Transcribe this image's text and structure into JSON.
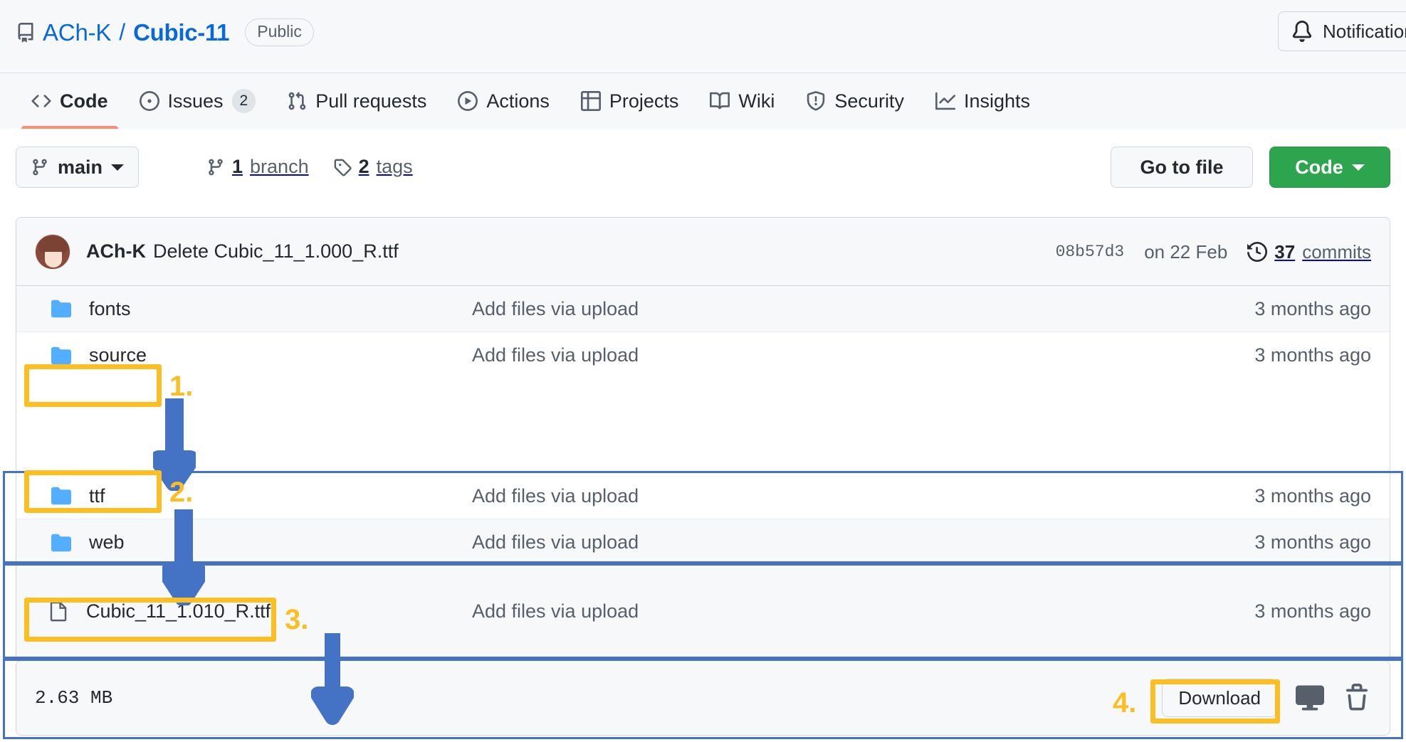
{
  "header": {
    "repo_icon": "repo-icon",
    "owner": "ACh-K",
    "separator": "/",
    "name": "Cubic-11",
    "visibility": "Public",
    "notifications_label": "Notifications",
    "notifications_icon": "bell-icon"
  },
  "nav": {
    "tabs": [
      {
        "label": "Code",
        "icon": "code-icon",
        "count": null,
        "active": true
      },
      {
        "label": "Issues",
        "icon": "issue-opened-icon",
        "count": "2",
        "active": false
      },
      {
        "label": "Pull requests",
        "icon": "git-pull-request-icon",
        "count": null,
        "active": false
      },
      {
        "label": "Actions",
        "icon": "play-icon",
        "count": null,
        "active": false
      },
      {
        "label": "Projects",
        "icon": "table-icon",
        "count": null,
        "active": false
      },
      {
        "label": "Wiki",
        "icon": "book-icon",
        "count": null,
        "active": false
      },
      {
        "label": "Security",
        "icon": "shield-icon",
        "count": null,
        "active": false
      },
      {
        "label": "Insights",
        "icon": "graph-icon",
        "count": null,
        "active": false
      }
    ]
  },
  "toolbar": {
    "branch_name": "main",
    "branch_icon": "git-branch-icon",
    "branch_count": "1",
    "branch_word": "branch",
    "tag_count": "2",
    "tag_word": "tags",
    "tag_icon": "tag-icon",
    "go_to_file_label": "Go to file",
    "code_label": "Code"
  },
  "commit_bar": {
    "avatar": "user-avatar",
    "author": "ACh-K",
    "message": "Delete Cubic_11_1.000_R.ttf",
    "hash": "08b57d3",
    "date": "on 22 Feb",
    "commits_count": "37",
    "commits_word": "commits",
    "history_icon": "history-icon"
  },
  "files": [
    {
      "name": "fonts",
      "type": "folder",
      "commit": "Add files via upload",
      "time": "3 months ago"
    },
    {
      "name": "source",
      "type": "folder",
      "commit": "Add files via upload",
      "time": "3 months ago"
    },
    {
      "name": "ttf",
      "type": "folder",
      "commit": "Add files via upload",
      "time": "3 months ago"
    },
    {
      "name": "web",
      "type": "folder",
      "commit": "Add files via upload",
      "time": "3 months ago"
    },
    {
      "name": "Cubic_11_1.010_R.ttf",
      "type": "file",
      "commit": "Add files via upload",
      "time": "3 months ago"
    }
  ],
  "footer": {
    "file_size": "2.63 MB",
    "download_label": "Download",
    "desktop_icon": "device-desktop-icon",
    "trash_icon": "trash-icon"
  },
  "annotations": {
    "steps": [
      {
        "number": "1.",
        "target": "fonts"
      },
      {
        "number": "2.",
        "target": "ttf"
      },
      {
        "number": "3.",
        "target": "Cubic_11_1.010_R.ttf"
      },
      {
        "number": "4.",
        "target": "Download"
      }
    ],
    "highlight_color": "#fbbf24",
    "arrow_color": "#4472c4",
    "outline_color": "#4472c4"
  }
}
